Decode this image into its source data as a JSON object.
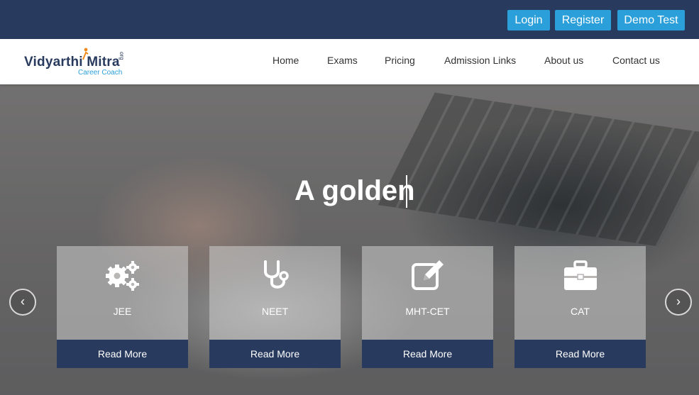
{
  "topbar": {
    "login_label": "Login",
    "register_label": "Register",
    "demo_label": "Demo Test"
  },
  "logo": {
    "main": "Vidyarthi Mitra",
    "org": "org",
    "sub": "Career Coach"
  },
  "nav": {
    "items": [
      {
        "label": "Home"
      },
      {
        "label": "Exams"
      },
      {
        "label": "Pricing"
      },
      {
        "label": "Admission Links"
      },
      {
        "label": "About us"
      },
      {
        "label": "Contact us"
      }
    ]
  },
  "hero": {
    "headline": "A golden",
    "prev_glyph": "‹",
    "next_glyph": "›"
  },
  "cards": [
    {
      "title": "JEE",
      "button": "Read More",
      "icon": "gears-icon"
    },
    {
      "title": "NEET",
      "button": "Read More",
      "icon": "stethoscope-icon"
    },
    {
      "title": "MHT-CET",
      "button": "Read More",
      "icon": "edit-icon"
    },
    {
      "title": "CAT",
      "button": "Read More",
      "icon": "briefcase-icon"
    }
  ],
  "colors": {
    "navy": "#283a5e",
    "accent_blue": "#2b9fd9"
  }
}
